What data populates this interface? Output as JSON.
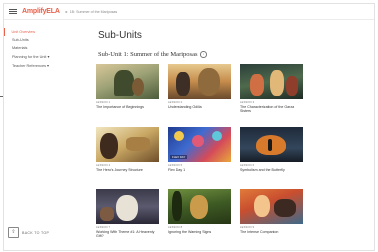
{
  "header": {
    "logo": "AmplifyELA",
    "breadcrumb_sep": "▸",
    "breadcrumb": "1B: Summer of the Mariposas"
  },
  "sidebar": {
    "items": [
      {
        "label": "Unit Overview"
      },
      {
        "label": "Sub-Units"
      },
      {
        "label": "Materials"
      },
      {
        "label": "Planning for the Unit ▾"
      },
      {
        "label": "Teacher References ▾"
      }
    ],
    "back_to_top": "BACK TO TOP",
    "back_icon": "⇧"
  },
  "main": {
    "title": "Sub-Units",
    "subunit_title": "Sub-Unit 1: Summer of the Mariposas",
    "info_icon": "i",
    "lessons": [
      {
        "num": "LESSON 1",
        "title": "The Importance of Beginnings"
      },
      {
        "num": "LESSON 2",
        "title": "Understanding Odilia"
      },
      {
        "num": "LESSON 3",
        "title": "The Characterization of the Garza Sisters"
      },
      {
        "num": "LESSON 4",
        "title": "The Hero's Journey Structure"
      },
      {
        "num": "LESSON 5",
        "title": "Flex Day 1",
        "tag": "FLEX DAY"
      },
      {
        "num": "LESSON 6",
        "title": "Symbolism and the Butterfly"
      },
      {
        "num": "LESSON 7",
        "title": "Working With Theme #1: A Heavenly Gift?"
      },
      {
        "num": "LESSON 8",
        "title": "Ignoring the Warning Signs"
      },
      {
        "num": "LESSON 9",
        "title": "The Intense Companion"
      }
    ]
  }
}
